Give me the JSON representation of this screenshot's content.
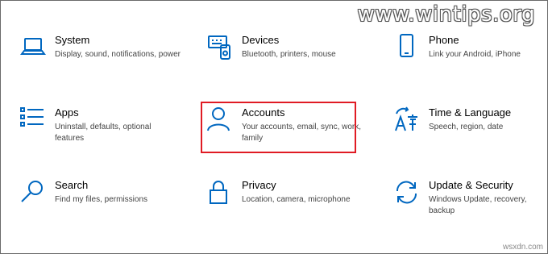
{
  "watermark": "www.wintips.org",
  "footer_mark": "wsxdn.com",
  "tiles": [
    {
      "icon": "laptop-icon",
      "title": "System",
      "desc": "Display, sound, notifications, power"
    },
    {
      "icon": "devices-icon",
      "title": "Devices",
      "desc": "Bluetooth, printers, mouse"
    },
    {
      "icon": "phone-icon",
      "title": "Phone",
      "desc": "Link your Android, iPhone"
    },
    {
      "icon": "apps-icon",
      "title": "Apps",
      "desc": "Uninstall, defaults, optional features"
    },
    {
      "icon": "person-icon",
      "title": "Accounts",
      "desc": "Your accounts, email, sync, work, family"
    },
    {
      "icon": "language-icon",
      "title": "Time & Language",
      "desc": "Speech, region, date"
    },
    {
      "icon": "search-icon",
      "title": "Search",
      "desc": "Find my files, permissions"
    },
    {
      "icon": "lock-icon",
      "title": "Privacy",
      "desc": "Location, camera, microphone"
    },
    {
      "icon": "sync-icon",
      "title": "Update & Security",
      "desc": "Windows Update, recovery, backup"
    }
  ],
  "colors": {
    "accent": "#0067c0",
    "highlight": "#e01b24"
  }
}
